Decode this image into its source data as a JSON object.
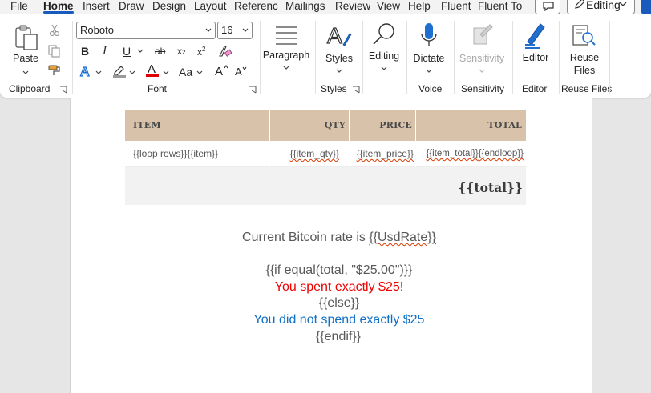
{
  "tabs": [
    "File",
    "Home",
    "Insert",
    "Draw",
    "Design",
    "Layout",
    "References",
    "Mailings",
    "Review",
    "View",
    "Help",
    "Fluent",
    "Fluent To"
  ],
  "editing_mode": "Editing",
  "ribbon": {
    "clipboard": {
      "paste": "Paste",
      "group": "Clipboard"
    },
    "font": {
      "name": "Roboto",
      "size": "16",
      "group": "Font",
      "change_case": "Aa"
    },
    "paragraph": {
      "label": "Paragraph"
    },
    "styles": {
      "label": "Styles",
      "group": "Styles"
    },
    "editing": {
      "label": "Editing"
    },
    "voice": {
      "dictate": "Dictate",
      "group": "Voice"
    },
    "sensitivity": {
      "label": "Sensitivity",
      "group": "Sensitivity"
    },
    "editor": {
      "label": "Editor",
      "group": "Editor"
    },
    "reuse": {
      "label_line1": "Reuse",
      "label_line2": "Files",
      "group": "Reuse Files"
    }
  },
  "colors": {
    "accent": "#185abd",
    "header_fill": "#d9c2aa",
    "red_text": "#ee0000",
    "blue_text": "#0f6fc6",
    "font_color_bar": "#e00000"
  },
  "document": {
    "table": {
      "headers": [
        "ITEM",
        "QTY",
        "PRICE",
        "TOTAL"
      ],
      "row": {
        "item": "{{loop rows}}{{item}}",
        "qty": "{{item_qty}}",
        "price": "{{item_price}}",
        "total_a": "{{item_total}}",
        "total_b": "{{endloop}}"
      },
      "total": "{{total}}"
    },
    "lines": {
      "bitcoin_prefix": "Current Bitcoin rate is ",
      "bitcoin_tag": "{{UsdRate}}",
      "if_cond": "{{if equal(total, \"$25.00\")}}",
      "spent": "You spent exactly $25!",
      "else": "{{else}}",
      "not_spent": "You did not spend exactly $25",
      "endif": "{{endif}}"
    }
  }
}
